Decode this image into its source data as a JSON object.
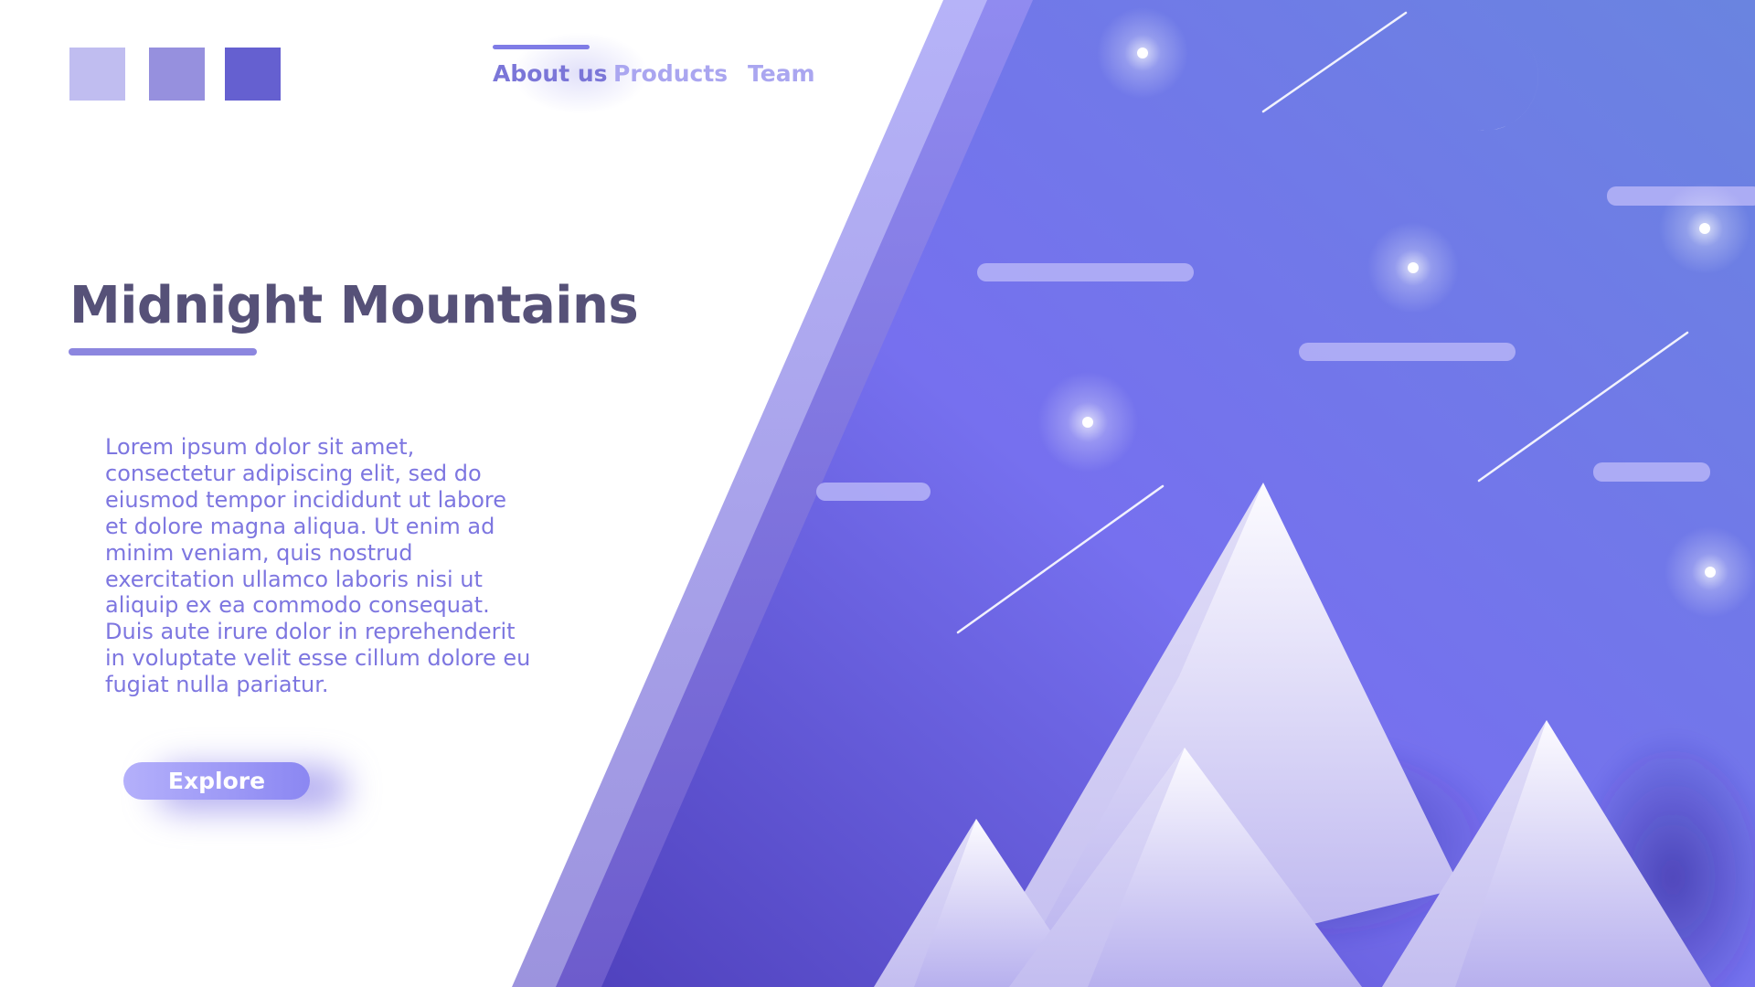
{
  "brand": {
    "swatch_colors": [
      "#c0bdf0",
      "#9690de",
      "#6560d0"
    ]
  },
  "nav": {
    "items": [
      {
        "label": "About us",
        "active": true
      },
      {
        "label": "Products",
        "active": false
      },
      {
        "label": "Team",
        "active": false
      }
    ]
  },
  "hero": {
    "title": "Midnight Mountains",
    "body": "Lorem ipsum dolor sit amet, consectetur adipiscing elit, sed do eiusmod tempor incididunt ut labore et dolore magna aliqua. Ut enim ad minim veniam, quis nostrud exercitation ullamco laboris nisi ut aliquip ex ea commodo consequat. Duis aute irure dolor in reprehenderit in voluptate velit esse cillum dolore eu fugiat nulla pariatur.",
    "button_label": "Explore"
  },
  "colors": {
    "accent": "#6560d0",
    "nav_active": "#7b76d8",
    "nav_inactive": "#aaa6f0",
    "title": "#565178",
    "body_text": "#7d76e0",
    "sky_top": "#6a83e2",
    "sky_bottom": "#5645c0"
  },
  "illustration": {
    "icons": [
      "crescent-moon-icon",
      "star-icon",
      "shooting-star-icon",
      "cloud-icon",
      "mountain-icon"
    ]
  }
}
